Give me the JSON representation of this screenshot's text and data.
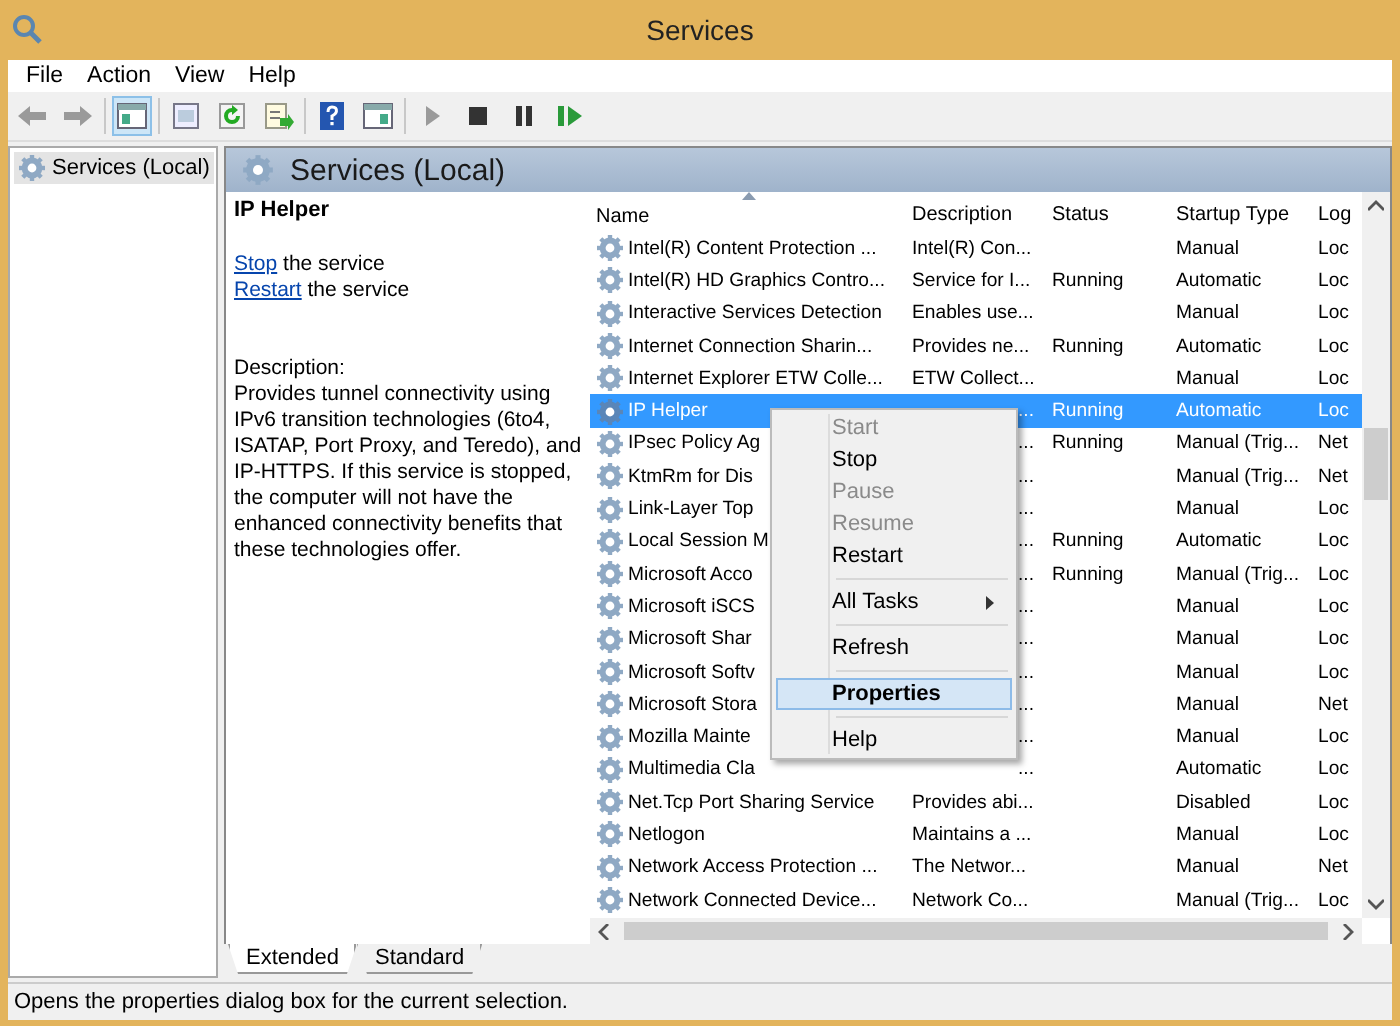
{
  "window": {
    "title": "Services"
  },
  "menu_bar": [
    "File",
    "Action",
    "View",
    "Help"
  ],
  "toolbar": [
    {
      "kind": "back"
    },
    {
      "kind": "forward"
    },
    {
      "kind": "sep"
    },
    {
      "kind": "tree",
      "pressed": true
    },
    {
      "kind": "sep"
    },
    {
      "kind": "props"
    },
    {
      "kind": "refresh"
    },
    {
      "kind": "export"
    },
    {
      "kind": "sep"
    },
    {
      "kind": "help"
    },
    {
      "kind": "pane"
    },
    {
      "kind": "sep"
    },
    {
      "kind": "play"
    },
    {
      "kind": "stop"
    },
    {
      "kind": "pause"
    },
    {
      "kind": "resume"
    }
  ],
  "tree": {
    "items": [
      {
        "label": "Services (Local)",
        "selected": true
      }
    ]
  },
  "panel": {
    "title": "Services (Local)"
  },
  "details": {
    "service": "IP Helper",
    "actions": [
      {
        "link": "Stop",
        "text": "the service"
      },
      {
        "link": "Restart",
        "text": "the service"
      }
    ],
    "description_label": "Description:",
    "description": "Provides tunnel connectivity using IPv6 transition technologies (6to4, ISATAP, Port Proxy, and Teredo), and IP-HTTPS. If this service is stopped, the computer will not have the enhanced connectivity benefits that these technologies offer."
  },
  "table": {
    "columns": [
      {
        "label": "Name",
        "sorted": true
      },
      {
        "label": "Description",
        "sorted": false
      },
      {
        "label": "Status",
        "sorted": false
      },
      {
        "label": "Startup Type",
        "sorted": false
      },
      {
        "label": "Log",
        "sorted": false
      }
    ],
    "rows": [
      {
        "name": "Intel(R) Content Protection ...",
        "description": "Intel(R) Con...",
        "status": "",
        "startup": "Manual",
        "logon": "Loc",
        "selected": false,
        "covered": false
      },
      {
        "name": "Intel(R) HD Graphics Contro...",
        "description": "Service for I...",
        "status": "Running",
        "startup": "Automatic",
        "logon": "Loc",
        "selected": false,
        "covered": false
      },
      {
        "name": "Interactive Services Detection",
        "description": "Enables use...",
        "status": "",
        "startup": "Manual",
        "logon": "Loc",
        "selected": false,
        "covered": false
      },
      {
        "name": "Internet Connection Sharin...",
        "description": "Provides ne...",
        "status": "Running",
        "startup": "Automatic",
        "logon": "Loc",
        "selected": false,
        "covered": false
      },
      {
        "name": "Internet Explorer ETW Colle...",
        "description": "ETW Collect...",
        "status": "",
        "startup": "Manual",
        "logon": "Loc",
        "selected": false,
        "covered": false
      },
      {
        "name": "IP Helper",
        "description": "...",
        "status": "Running",
        "startup": "Automatic",
        "logon": "Loc",
        "selected": true,
        "covered": true
      },
      {
        "name": "IPsec Policy Ag",
        "description": "...",
        "status": "Running",
        "startup": "Manual (Trig...",
        "logon": "Net",
        "selected": false,
        "covered": true
      },
      {
        "name": "KtmRm for Dis",
        "description": "...",
        "status": "",
        "startup": "Manual (Trig...",
        "logon": "Net",
        "selected": false,
        "covered": true
      },
      {
        "name": "Link-Layer Top",
        "description": "...",
        "status": "",
        "startup": "Manual",
        "logon": "Loc",
        "selected": false,
        "covered": true
      },
      {
        "name": "Local Session M",
        "description": "...",
        "status": "Running",
        "startup": "Automatic",
        "logon": "Loc",
        "selected": false,
        "covered": true
      },
      {
        "name": "Microsoft Acco",
        "description": "...",
        "status": "Running",
        "startup": "Manual (Trig...",
        "logon": "Loc",
        "selected": false,
        "covered": true
      },
      {
        "name": "Microsoft iSCS",
        "description": "...",
        "status": "",
        "startup": "Manual",
        "logon": "Loc",
        "selected": false,
        "covered": true
      },
      {
        "name": "Microsoft Shar",
        "description": "...",
        "status": "",
        "startup": "Manual",
        "logon": "Loc",
        "selected": false,
        "covered": true
      },
      {
        "name": "Microsoft Softv",
        "description": "...",
        "status": "",
        "startup": "Manual",
        "logon": "Loc",
        "selected": false,
        "covered": true
      },
      {
        "name": "Microsoft Stora",
        "description": "...",
        "status": "",
        "startup": "Manual",
        "logon": "Net",
        "selected": false,
        "covered": true
      },
      {
        "name": "Mozilla Mainte",
        "description": "...",
        "status": "",
        "startup": "Manual",
        "logon": "Loc",
        "selected": false,
        "covered": true
      },
      {
        "name": "Multimedia Cla",
        "description": "...",
        "status": "",
        "startup": "Automatic",
        "logon": "Loc",
        "selected": false,
        "covered": true
      },
      {
        "name": "Net.Tcp Port Sharing Service",
        "description": "Provides abi...",
        "status": "",
        "startup": "Disabled",
        "logon": "Loc",
        "selected": false,
        "covered": false
      },
      {
        "name": "Netlogon",
        "description": "Maintains a ...",
        "status": "",
        "startup": "Manual",
        "logon": "Loc",
        "selected": false,
        "covered": false
      },
      {
        "name": "Network Access Protection ...",
        "description": "The Networ...",
        "status": "",
        "startup": "Manual",
        "logon": "Net",
        "selected": false,
        "covered": false
      },
      {
        "name": "Network Connected Device...",
        "description": "Network Co...",
        "status": "",
        "startup": "Manual (Trig...",
        "logon": "Loc",
        "selected": false,
        "covered": false
      }
    ]
  },
  "context_menu": [
    {
      "kind": "item",
      "label": "Start",
      "disabled": true,
      "selected": false
    },
    {
      "kind": "item",
      "label": "Stop",
      "disabled": false,
      "selected": false
    },
    {
      "kind": "item",
      "label": "Pause",
      "disabled": true,
      "selected": false
    },
    {
      "kind": "item",
      "label": "Resume",
      "disabled": true,
      "selected": false
    },
    {
      "kind": "item",
      "label": "Restart",
      "disabled": false,
      "selected": false
    },
    {
      "kind": "separator"
    },
    {
      "kind": "submenu",
      "label": "All Tasks",
      "disabled": false,
      "selected": false
    },
    {
      "kind": "separator"
    },
    {
      "kind": "item",
      "label": "Refresh",
      "disabled": false,
      "selected": false
    },
    {
      "kind": "separator"
    },
    {
      "kind": "item",
      "label": "Properties",
      "disabled": false,
      "selected": true
    },
    {
      "kind": "separator"
    },
    {
      "kind": "item",
      "label": "Help",
      "disabled": false,
      "selected": false
    }
  ],
  "view_tabs": [
    {
      "label": "Extended",
      "selected": true
    },
    {
      "label": "Standard",
      "selected": false
    }
  ],
  "status_bar": "Opens the properties dialog box for the current selection."
}
